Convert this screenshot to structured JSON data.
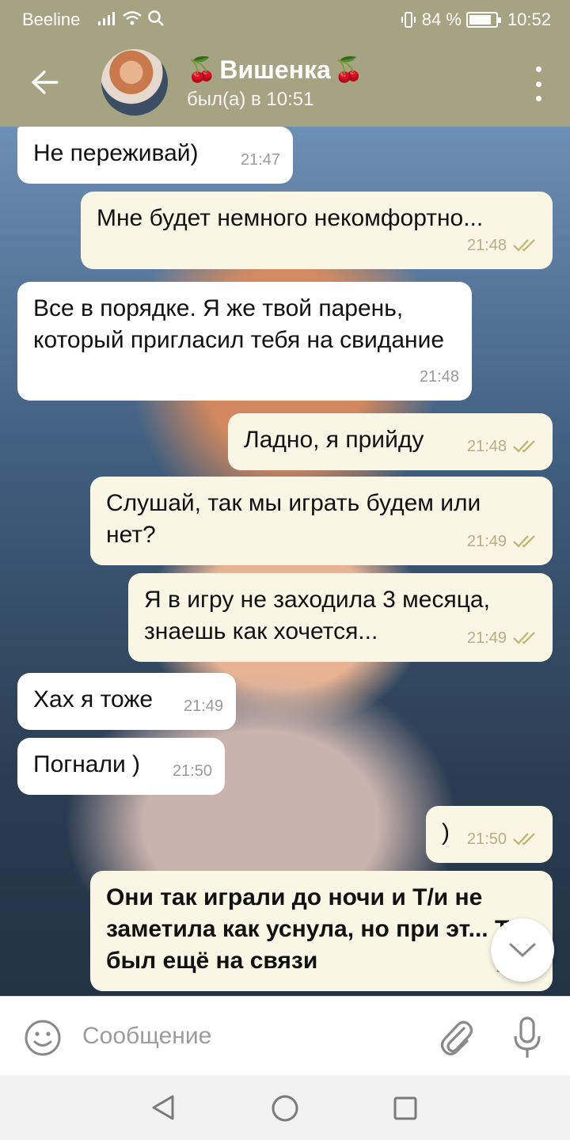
{
  "status_bar": {
    "carrier": "Beeline",
    "battery_text": "84 %",
    "battery_level": 0.84,
    "time": "10:52"
  },
  "header": {
    "title": "Вишенка",
    "title_emoji": "🍒",
    "subtitle": "был(а) в 10:51"
  },
  "messages": [
    {
      "text": "Не переживай)",
      "time": "21:47",
      "direction": "in"
    },
    {
      "text": "Мне будет немного некомфортно...",
      "time": "21:48",
      "direction": "out"
    },
    {
      "text": "Все в порядке. Я же твой парень, который пригласил тебя на свидание",
      "time": "21:48",
      "direction": "in"
    },
    {
      "text": "Ладно, я прийду",
      "time": "21:48",
      "direction": "out"
    },
    {
      "text": "Слушай, так мы играть будем или нет?",
      "time": "21:49",
      "direction": "out"
    },
    {
      "text": "Я в игру не заходила 3 месяца, знаешь как хочется...",
      "time": "21:49",
      "direction": "out"
    },
    {
      "text": "Хах я тоже",
      "time": "21:49",
      "direction": "in"
    },
    {
      "text": "Погнали )",
      "time": "21:50",
      "direction": "in"
    },
    {
      "text": ")",
      "time": "21:50",
      "direction": "out"
    },
    {
      "text": "Они так играли до ночи и Т/и не заметила как уснула, но при эт... Тэ был ещё на связи",
      "time": "21:5...",
      "direction": "out"
    }
  ],
  "input": {
    "placeholder": "Сообщение"
  },
  "colors": {
    "accent": "#a6a383",
    "outgoing_bubble": "#f9f6e6",
    "incoming_bubble": "#ffffff",
    "read_check": "#c2b97a"
  },
  "icons": [
    "back-arrow-icon",
    "more-vert-icon",
    "emoji-icon",
    "attach-icon",
    "mic-icon",
    "chevron-down-icon",
    "double-check-icon"
  ]
}
